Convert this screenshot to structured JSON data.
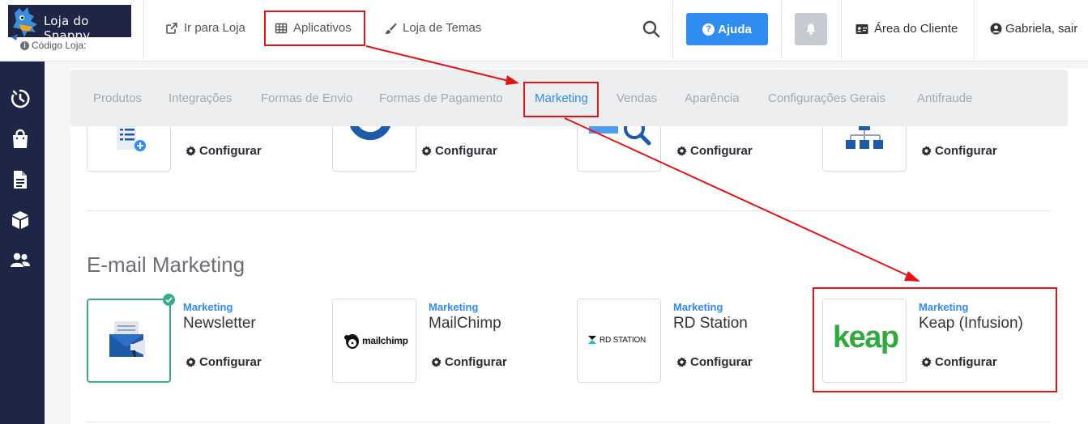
{
  "header": {
    "logo_text": "Loja do Snappy",
    "store_code_label": "Código Loja:",
    "store_code_value": "",
    "nav": {
      "store_link": "Ir para Loja",
      "apps_link": "Aplicativos",
      "themes_link": "Loja de Temas"
    },
    "help_label": "Ajuda",
    "client_area_label": "Área do Cliente",
    "user_label": "Gabriela, sair"
  },
  "sidebar": {
    "icons": [
      "dashboard-icon",
      "shopping-bag-icon",
      "document-icon",
      "box-icon",
      "users-icon"
    ]
  },
  "tabs": [
    {
      "label": "Produtos",
      "active": false
    },
    {
      "label": "Integrações",
      "active": false
    },
    {
      "label": "Formas de Envio",
      "active": false
    },
    {
      "label": "Formas de Pagamento",
      "active": false
    },
    {
      "label": "Marketing",
      "active": true
    },
    {
      "label": "Vendas",
      "active": false
    },
    {
      "label": "Aparência",
      "active": false
    },
    {
      "label": "Configurações Gerais",
      "active": false
    },
    {
      "label": "Antifraude",
      "active": false
    }
  ],
  "top_row_apps": [
    {
      "icon": "list-add-icon",
      "action": "Configurar"
    },
    {
      "icon": "circle-logo-icon",
      "action": "Configurar"
    },
    {
      "icon": "seo-search-icon",
      "action": "Configurar"
    },
    {
      "icon": "sitemap-icon",
      "action": "Configurar"
    }
  ],
  "section": {
    "title": "E-mail Marketing",
    "apps": [
      {
        "category": "Marketing",
        "name": "Newsletter",
        "action": "Configurar",
        "logo": "newsletter-icon",
        "installed": true
      },
      {
        "category": "Marketing",
        "name": "MailChimp",
        "action": "Configurar",
        "logo_text": "mailchimp",
        "installed": false
      },
      {
        "category": "Marketing",
        "name": "RD Station",
        "action": "Configurar",
        "logo_text": "RD STATION",
        "installed": false
      },
      {
        "category": "Marketing",
        "name": "Keap (Infusion)",
        "action": "Configurar",
        "logo_text": "keap",
        "installed": false
      }
    ]
  },
  "colors": {
    "sidebar": "#1e2547",
    "accent": "#2f8cf0",
    "installed": "#3aaa8d",
    "annotation": "#e01515",
    "keap_green": "#2eaa3f"
  }
}
